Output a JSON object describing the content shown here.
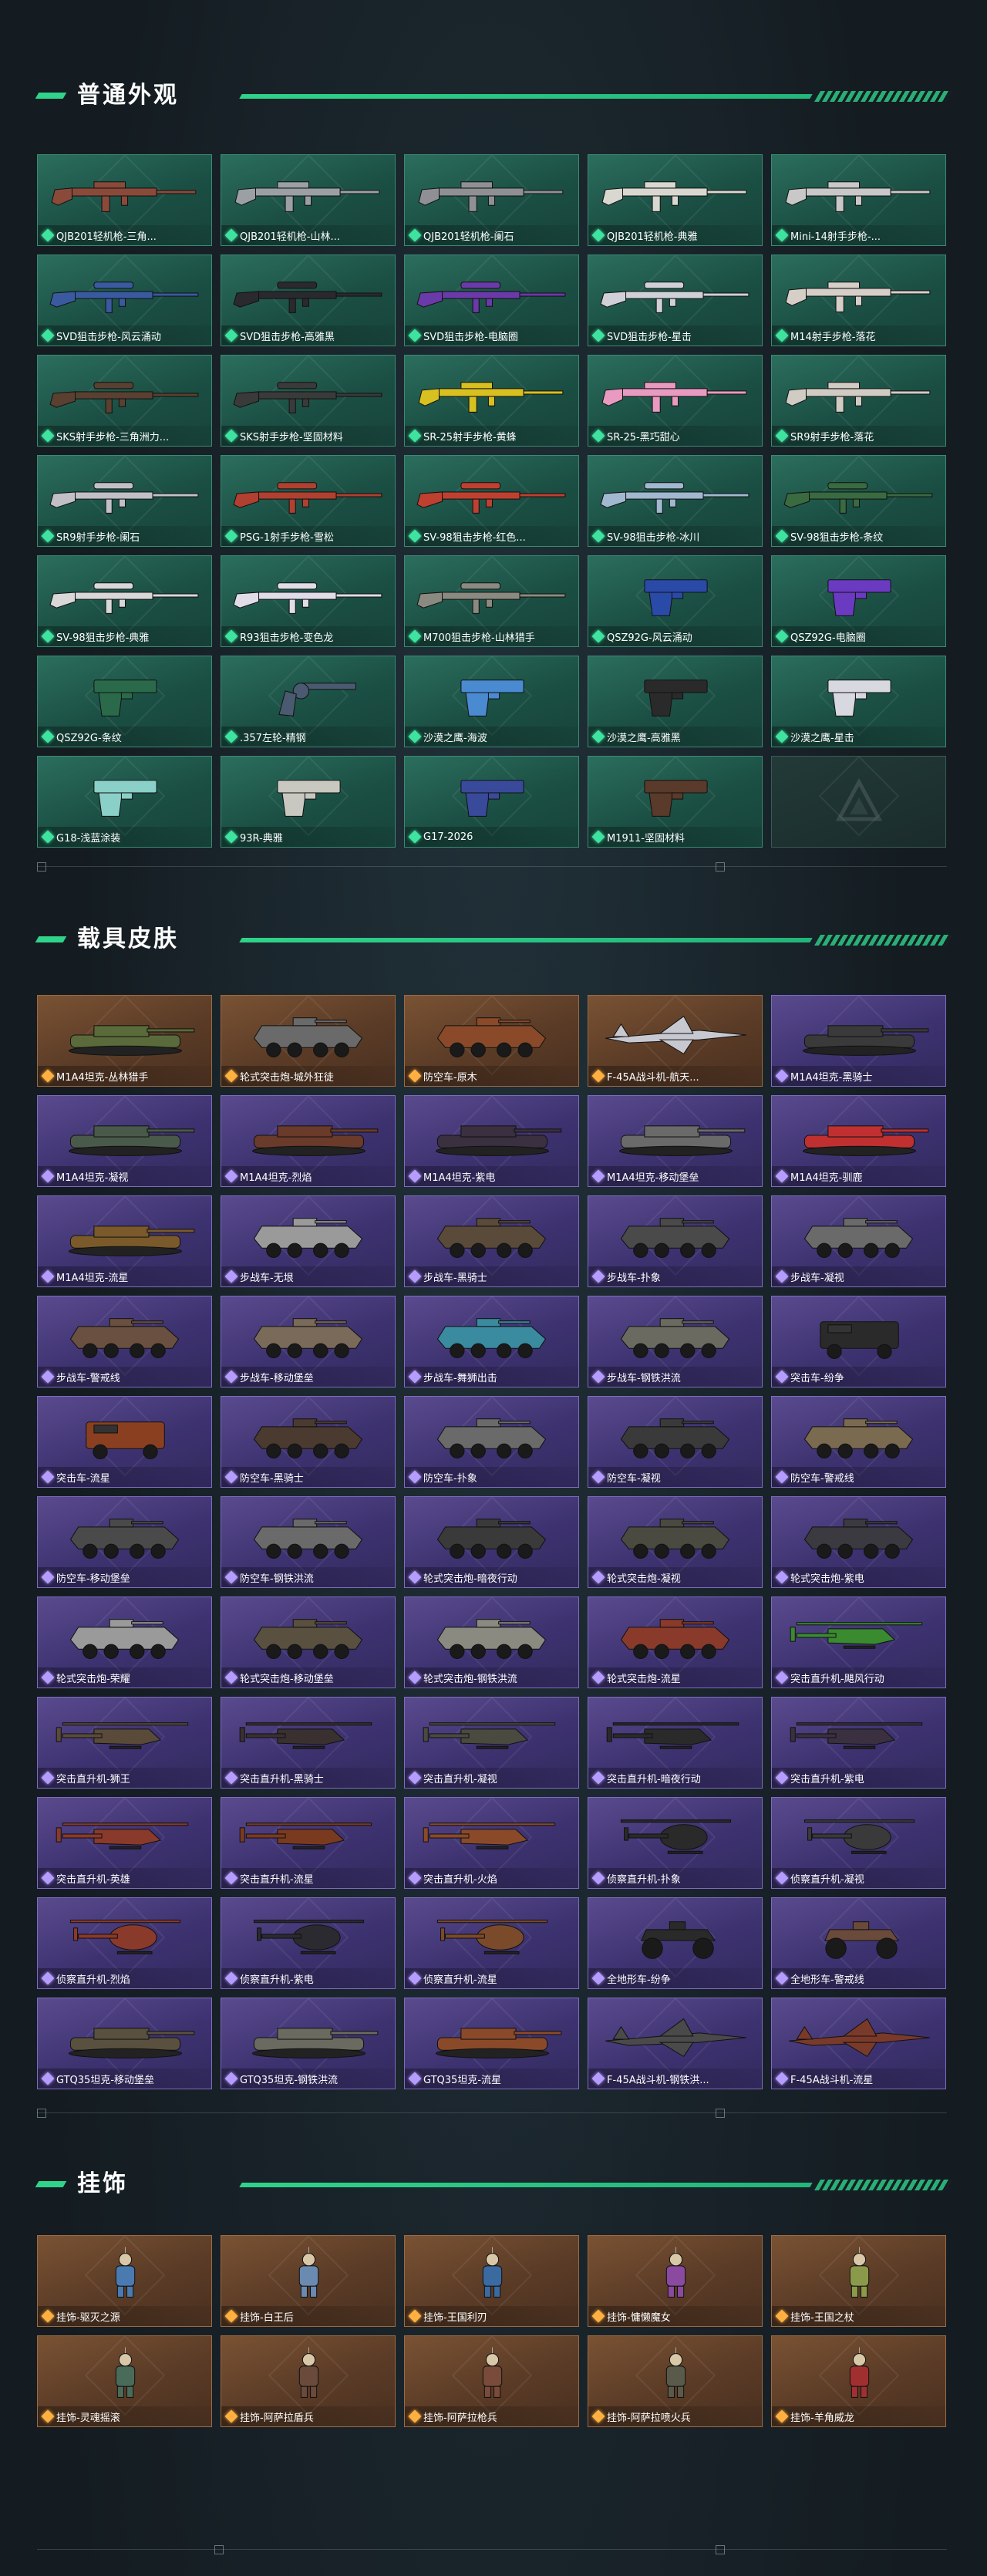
{
  "colors": {
    "accent": "#2fd38a",
    "green_card": "#1f5a4c",
    "orange_card": "#6b4630",
    "purple_card": "#4a3d80"
  },
  "sections": [
    {
      "title": "普通外观",
      "items": [
        {
          "name": "QJB201轻机枪-三角...",
          "rarity": "green",
          "kind": "rifle",
          "skin": "#8a4a3a"
        },
        {
          "name": "QJB201轻机枪-山林...",
          "rarity": "green",
          "kind": "rifle",
          "skin": "#9aa0a4"
        },
        {
          "name": "QJB201轻机枪-阑石",
          "rarity": "green",
          "kind": "rifle",
          "skin": "#8e9094"
        },
        {
          "name": "QJB201轻机枪-典雅",
          "rarity": "green",
          "kind": "rifle",
          "skin": "#d8d8d0"
        },
        {
          "name": "Mini-14射手步枪-...",
          "rarity": "green",
          "kind": "rifle",
          "skin": "#c8c8c8"
        },
        {
          "name": "SVD狙击步枪-风云涌动",
          "rarity": "green",
          "kind": "sniper",
          "skin": "#3a5aa0"
        },
        {
          "name": "SVD狙击步枪-高雅黑",
          "rarity": "green",
          "kind": "sniper",
          "skin": "#2a2a2e"
        },
        {
          "name": "SVD狙击步枪-电脑圈",
          "rarity": "green",
          "kind": "sniper",
          "skin": "#6a3aa8"
        },
        {
          "name": "SVD狙击步枪-星击",
          "rarity": "green",
          "kind": "sniper",
          "skin": "#d0d0d8"
        },
        {
          "name": "M14射手步枪-落花",
          "rarity": "green",
          "kind": "rifle",
          "skin": "#d6cfc8"
        },
        {
          "name": "SKS射手步枪-三角洲力...",
          "rarity": "green",
          "kind": "sniper",
          "skin": "#5a4030"
        },
        {
          "name": "SKS射手步枪-坚固材料",
          "rarity": "green",
          "kind": "sniper",
          "skin": "#3a3a3a"
        },
        {
          "name": "SR-25射手步枪-黄蜂",
          "rarity": "green",
          "kind": "rifle",
          "skin": "#d8c020"
        },
        {
          "name": "SR-25-黑巧甜心",
          "rarity": "green",
          "kind": "rifle",
          "skin": "#e89ac0"
        },
        {
          "name": "SR9射手步枪-落花",
          "rarity": "green",
          "kind": "rifle",
          "skin": "#d0ccc4"
        },
        {
          "name": "SR9射手步枪-阑石",
          "rarity": "green",
          "kind": "sniper",
          "skin": "#c0c0c6"
        },
        {
          "name": "PSG-1射手步枪-雪松",
          "rarity": "green",
          "kind": "sniper",
          "skin": "#b04030"
        },
        {
          "name": "SV-98狙击步枪-红色...",
          "rarity": "green",
          "kind": "sniper",
          "skin": "#c04030"
        },
        {
          "name": "SV-98狙击步枪-冰川",
          "rarity": "green",
          "kind": "sniper",
          "skin": "#a0b8d0"
        },
        {
          "name": "SV-98狙击步枪-条纹",
          "rarity": "green",
          "kind": "sniper",
          "skin": "#3a6a40"
        },
        {
          "name": "SV-98狙击步枪-典雅",
          "rarity": "green",
          "kind": "sniper",
          "skin": "#d8d8d8"
        },
        {
          "name": "R93狙击步枪-变色龙",
          "rarity": "green",
          "kind": "sniper",
          "skin": "#e0dce8"
        },
        {
          "name": "M700狙击步枪-山林猎手",
          "rarity": "green",
          "kind": "sniper",
          "skin": "#8a8a80"
        },
        {
          "name": "QSZ92G-风云涌动",
          "rarity": "green",
          "kind": "pistol",
          "skin": "#2a4aa8"
        },
        {
          "name": "QSZ92G-电脑圈",
          "rarity": "green",
          "kind": "pistol",
          "skin": "#6a3ac0"
        },
        {
          "name": "QSZ92G-条纹",
          "rarity": "green",
          "kind": "pistol",
          "skin": "#2a6a4a"
        },
        {
          "name": ".357左轮-精钢",
          "rarity": "green",
          "kind": "revolver",
          "skin": "#4a5a70"
        },
        {
          "name": "沙漠之鹰-海波",
          "rarity": "green",
          "kind": "pistol",
          "skin": "#4a8ad0"
        },
        {
          "name": "沙漠之鹰-高雅黑",
          "rarity": "green",
          "kind": "pistol",
          "skin": "#2a2a2a"
        },
        {
          "name": "沙漠之鹰-星击",
          "rarity": "green",
          "kind": "pistol",
          "skin": "#d8d8e0"
        },
        {
          "name": "G18-浅蓝涂装",
          "rarity": "green",
          "kind": "pistol",
          "skin": "#8ad0c8"
        },
        {
          "name": "93R-典雅",
          "rarity": "green",
          "kind": "pistol",
          "skin": "#c8c8c0"
        },
        {
          "name": "G17-2026",
          "rarity": "green",
          "kind": "pistol",
          "skin": "#3a4a9a"
        },
        {
          "name": "M1911-坚固材料",
          "rarity": "green",
          "kind": "pistol",
          "skin": "#5a3a2a"
        },
        {
          "name": "",
          "rarity": "empty",
          "kind": "empty",
          "skin": ""
        }
      ]
    },
    {
      "title": "载具皮肤",
      "items": [
        {
          "name": "M1A4坦克-丛林猎手",
          "rarity": "orange",
          "kind": "tank",
          "skin": "#5a6a3a"
        },
        {
          "name": "轮式突击炮-城外狂徒",
          "rarity": "orange",
          "kind": "apc",
          "skin": "#6a6a6a"
        },
        {
          "name": "防空车-原木",
          "rarity": "orange",
          "kind": "apc",
          "skin": "#8a4a2a"
        },
        {
          "name": "F-45A战斗机-航天...",
          "rarity": "orange",
          "kind": "jet",
          "skin": "#c8c8d0"
        },
        {
          "name": "M1A4坦克-黑骑士",
          "rarity": "purple",
          "kind": "tank",
          "skin": "#3a3a3a"
        },
        {
          "name": "M1A4坦克-凝视",
          "rarity": "purple",
          "kind": "tank",
          "skin": "#4a5a4a"
        },
        {
          "name": "M1A4坦克-烈焰",
          "rarity": "purple",
          "kind": "tank",
          "skin": "#6a3a2a"
        },
        {
          "name": "M1A4坦克-紫电",
          "rarity": "purple",
          "kind": "tank",
          "skin": "#3a3040"
        },
        {
          "name": "M1A4坦克-移动堡垒",
          "rarity": "purple",
          "kind": "tank",
          "skin": "#6a6a6a"
        },
        {
          "name": "M1A4坦克-驯鹿",
          "rarity": "purple",
          "kind": "tank",
          "skin": "#c03030"
        },
        {
          "name": "M1A4坦克-流星",
          "rarity": "purple",
          "kind": "tank",
          "skin": "#7a5a2a"
        },
        {
          "name": "步战车-无垠",
          "rarity": "purple",
          "kind": "apc",
          "skin": "#9a9a9a"
        },
        {
          "name": "步战车-黑骑士",
          "rarity": "purple",
          "kind": "apc",
          "skin": "#5a4a3a"
        },
        {
          "name": "步战车-扑象",
          "rarity": "purple",
          "kind": "apc",
          "skin": "#4a4a4a"
        },
        {
          "name": "步战车-凝视",
          "rarity": "purple",
          "kind": "apc",
          "skin": "#6a6a6a"
        },
        {
          "name": "步战车-警戒线",
          "rarity": "purple",
          "kind": "apc",
          "skin": "#6a5040"
        },
        {
          "name": "步战车-移动堡垒",
          "rarity": "purple",
          "kind": "apc",
          "skin": "#7a6a5a"
        },
        {
          "name": "步战车-舞狮出击",
          "rarity": "purple",
          "kind": "apc",
          "skin": "#3a8aa0"
        },
        {
          "name": "步战车-钢铁洪流",
          "rarity": "purple",
          "kind": "apc",
          "skin": "#6a6a60"
        },
        {
          "name": "突击车-纷争",
          "rarity": "purple",
          "kind": "truck",
          "skin": "#2a2a2a"
        },
        {
          "name": "突击车-流星",
          "rarity": "purple",
          "kind": "truck",
          "skin": "#8a4020"
        },
        {
          "name": "防空车-黑骑士",
          "rarity": "purple",
          "kind": "apc",
          "skin": "#4a3a30"
        },
        {
          "name": "防空车-扑象",
          "rarity": "purple",
          "kind": "apc",
          "skin": "#6a6a6a"
        },
        {
          "name": "防空车-凝视",
          "rarity": "purple",
          "kind": "apc",
          "skin": "#3a3a3a"
        },
        {
          "name": "防空车-警戒线",
          "rarity": "purple",
          "kind": "apc",
          "skin": "#7a6a50"
        },
        {
          "name": "防空车-移动堡垒",
          "rarity": "purple",
          "kind": "apc",
          "skin": "#4a4a4a"
        },
        {
          "name": "防空车-钢铁洪流",
          "rarity": "purple",
          "kind": "apc",
          "skin": "#6a6a6a"
        },
        {
          "name": "轮式突击炮-暗夜行动",
          "rarity": "purple",
          "kind": "apc",
          "skin": "#3a3a3a"
        },
        {
          "name": "轮式突击炮-凝视",
          "rarity": "purple",
          "kind": "apc",
          "skin": "#4a4a40"
        },
        {
          "name": "轮式突击炮-紫电",
          "rarity": "purple",
          "kind": "apc",
          "skin": "#3a3a40"
        },
        {
          "name": "轮式突击炮-荣耀",
          "rarity": "purple",
          "kind": "apc",
          "skin": "#9a9a9a"
        },
        {
          "name": "轮式突击炮-移动堡垒",
          "rarity": "purple",
          "kind": "apc",
          "skin": "#5a5040"
        },
        {
          "name": "轮式突击炮-钢铁洪流",
          "rarity": "purple",
          "kind": "apc",
          "skin": "#8a8a80"
        },
        {
          "name": "轮式突击炮-流星",
          "rarity": "purple",
          "kind": "apc",
          "skin": "#8a3a2a"
        },
        {
          "name": "突击直升机-飓风行动",
          "rarity": "purple",
          "kind": "heli",
          "skin": "#3a8a30"
        },
        {
          "name": "突击直升机-狮王",
          "rarity": "purple",
          "kind": "heli",
          "skin": "#5a4a3a"
        },
        {
          "name": "突击直升机-黑骑士",
          "rarity": "purple",
          "kind": "heli",
          "skin": "#3a3030"
        },
        {
          "name": "突击直升机-凝视",
          "rarity": "purple",
          "kind": "heli",
          "skin": "#4a4a40"
        },
        {
          "name": "突击直升机-暗夜行动",
          "rarity": "purple",
          "kind": "heli",
          "skin": "#2a2a2a"
        },
        {
          "name": "突击直升机-紫电",
          "rarity": "purple",
          "kind": "heli",
          "skin": "#3a3040"
        },
        {
          "name": "突击直升机-英雄",
          "rarity": "purple",
          "kind": "heli",
          "skin": "#8a3a2a"
        },
        {
          "name": "突击直升机-流星",
          "rarity": "purple",
          "kind": "heli",
          "skin": "#7a3a20"
        },
        {
          "name": "突击直升机-火焰",
          "rarity": "purple",
          "kind": "heli",
          "skin": "#8a4a2a"
        },
        {
          "name": "侦察直升机-扑象",
          "rarity": "purple",
          "kind": "lheli",
          "skin": "#2a2a2a"
        },
        {
          "name": "侦察直升机-凝视",
          "rarity": "purple",
          "kind": "lheli",
          "skin": "#3a3a3a"
        },
        {
          "name": "侦察直升机-烈焰",
          "rarity": "purple",
          "kind": "lheli",
          "skin": "#8a3a2a"
        },
        {
          "name": "侦察直升机-紫电",
          "rarity": "purple",
          "kind": "lheli",
          "skin": "#2a2a30"
        },
        {
          "name": "侦察直升机-流星",
          "rarity": "purple",
          "kind": "lheli",
          "skin": "#7a4a2a"
        },
        {
          "name": "全地形车-纷争",
          "rarity": "purple",
          "kind": "atv",
          "skin": "#2a2a2a"
        },
        {
          "name": "全地形车-警戒线",
          "rarity": "purple",
          "kind": "atv",
          "skin": "#6a4a3a"
        },
        {
          "name": "GTQ35坦克-移动堡垒",
          "rarity": "purple",
          "kind": "tank",
          "skin": "#5a5040"
        },
        {
          "name": "GTQ35坦克-钢铁洪流",
          "rarity": "purple",
          "kind": "tank",
          "skin": "#6a6a60"
        },
        {
          "name": "GTQ35坦克-流星",
          "rarity": "purple",
          "kind": "tank",
          "skin": "#8a4a2a"
        },
        {
          "name": "F-45A战斗机-钢铁洪...",
          "rarity": "purple",
          "kind": "jet",
          "skin": "#4a4a4a"
        },
        {
          "name": "F-45A战斗机-流星",
          "rarity": "purple",
          "kind": "jet",
          "skin": "#7a3a2a"
        }
      ]
    },
    {
      "title": "挂饰",
      "items": [
        {
          "name": "挂饰-驱灭之源",
          "rarity": "orange",
          "kind": "charm",
          "skin": "#4a7ab0"
        },
        {
          "name": "挂饰-白王后",
          "rarity": "orange",
          "kind": "charm",
          "skin": "#6a8ab0"
        },
        {
          "name": "挂饰-王国利刃",
          "rarity": "orange",
          "kind": "charm",
          "skin": "#3a6aa0"
        },
        {
          "name": "挂饰-慵懒魔女",
          "rarity": "orange",
          "kind": "charm",
          "skin": "#8a4aa0"
        },
        {
          "name": "挂饰-王国之杖",
          "rarity": "orange",
          "kind": "charm",
          "skin": "#8a9a4a"
        },
        {
          "name": "挂饰-灵魂摇滚",
          "rarity": "orange",
          "kind": "charm",
          "skin": "#4a6a5a"
        },
        {
          "name": "挂饰-阿萨拉盾兵",
          "rarity": "orange",
          "kind": "charm",
          "skin": "#6a4a3a"
        },
        {
          "name": "挂饰-阿萨拉枪兵",
          "rarity": "orange",
          "kind": "charm",
          "skin": "#7a4a3a"
        },
        {
          "name": "挂饰-阿萨拉喷火兵",
          "rarity": "orange",
          "kind": "charm",
          "skin": "#5a5a4a"
        },
        {
          "name": "挂饰-羊角威龙",
          "rarity": "orange",
          "kind": "charm",
          "skin": "#a03030"
        }
      ]
    }
  ]
}
